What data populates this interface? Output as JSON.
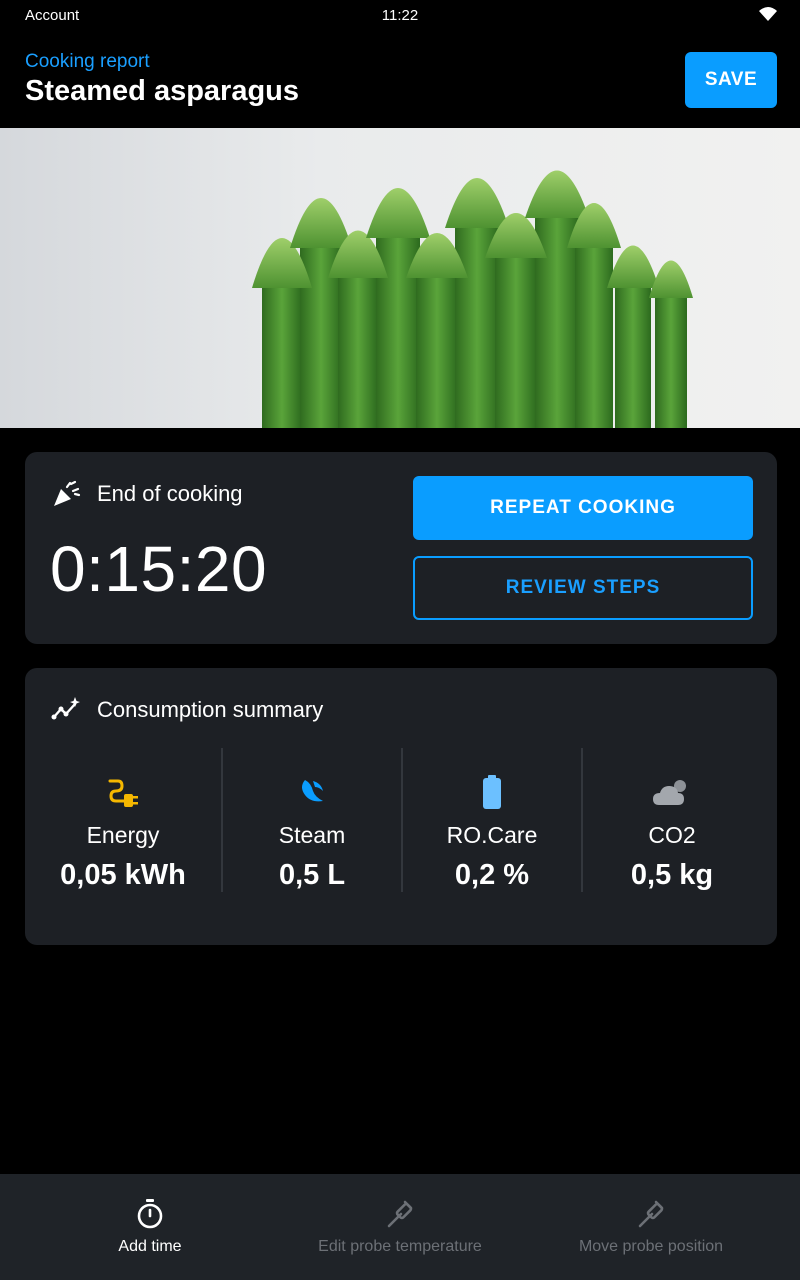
{
  "status_bar": {
    "left": "Account",
    "time": "11:22",
    "wifi_icon": "wifi-icon"
  },
  "header": {
    "subtitle": "Cooking report",
    "title": "Steamed asparagus",
    "save_label": "SAVE"
  },
  "hero": {
    "image": "asparagus-photo"
  },
  "end_of_cooking": {
    "icon": "party-popper-icon",
    "label": "End of cooking",
    "duration": "0:15:20",
    "repeat_label": "REPEAT COOKING",
    "review_label": "REVIEW STEPS"
  },
  "consumption": {
    "icon": "sparkle-chart-icon",
    "label": "Consumption summary",
    "items": [
      {
        "name": "Energy",
        "value": "0,05 kWh",
        "icon": "plug-icon",
        "color": "#f5b700"
      },
      {
        "name": "Steam",
        "value": "0,5 L",
        "icon": "steam-icon",
        "color": "#0a9dff"
      },
      {
        "name": "RO.Care",
        "value": "0,2 %",
        "icon": "battery-icon",
        "color": "#6cc0ff"
      },
      {
        "name": "CO2",
        "value": "0,5 kg",
        "icon": "cloud-icon",
        "color": "#9a9ea4"
      }
    ]
  },
  "bottom_nav": [
    {
      "label": "Add time",
      "icon": "stopwatch-icon",
      "enabled": true
    },
    {
      "label": "Edit probe temperature",
      "icon": "probe-icon",
      "enabled": false
    },
    {
      "label": "Move probe position",
      "icon": "probe-icon",
      "enabled": false
    }
  ],
  "colors": {
    "accent": "#0a9dff",
    "card": "#1d2025",
    "background": "#000000"
  }
}
